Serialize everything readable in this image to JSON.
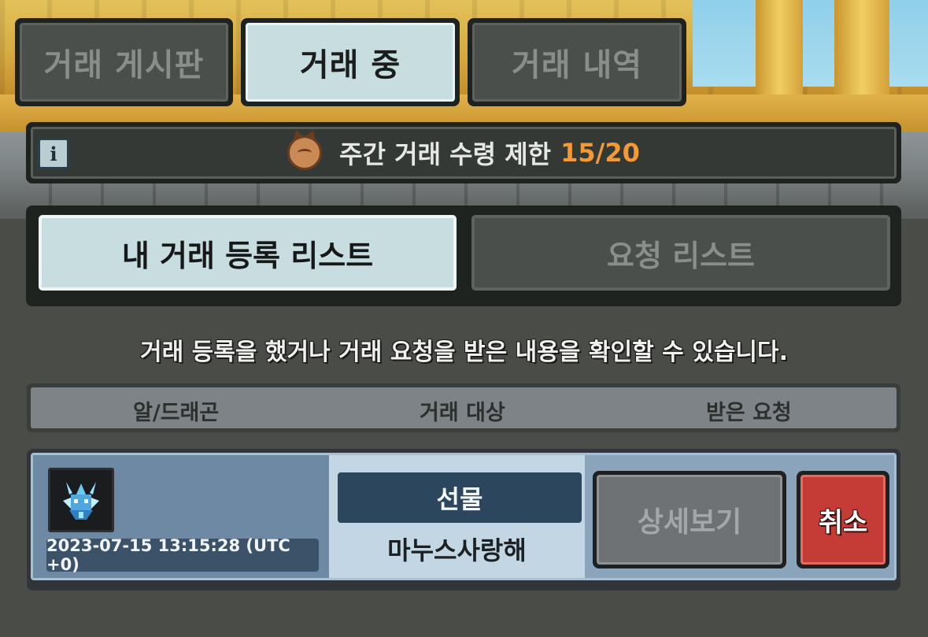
{
  "tabs": [
    {
      "label": "거래 게시판",
      "state": "inactive"
    },
    {
      "label": "거래 중",
      "state": "active"
    },
    {
      "label": "거래 내역",
      "state": "inactive"
    }
  ],
  "info_bar": {
    "info_icon": "info-icon",
    "currency_icon": "cat-coin-icon",
    "limit_label": "주간 거래 수령 제한",
    "limit_value": "15/20",
    "limit_value_color": "#f49a34"
  },
  "subtabs": [
    {
      "label": "내 거래 등록 리스트",
      "state": "active"
    },
    {
      "label": "요청 리스트",
      "state": "inactive"
    }
  ],
  "description": "거래 등록을 했거나 거래 요청을 받은 내용을 확인할 수 있습니다.",
  "columns": [
    "알/드래곤",
    "거래 대상",
    "받은 요청"
  ],
  "items": [
    {
      "dragon_icon": "ice-dragon-icon",
      "timestamp": "2023-07-15 13:15:28 (UTC +0)",
      "trade_type": "선물",
      "target": "마누스사랑해",
      "detail_label": "상세보기",
      "cancel_label": "취소"
    }
  ],
  "colors": {
    "active_tab_bg": "#c8dde0",
    "inactive_tab_bg": "#4b4f4b",
    "cancel_button": "#c53c36",
    "gift_label_bg": "#2c465e"
  }
}
